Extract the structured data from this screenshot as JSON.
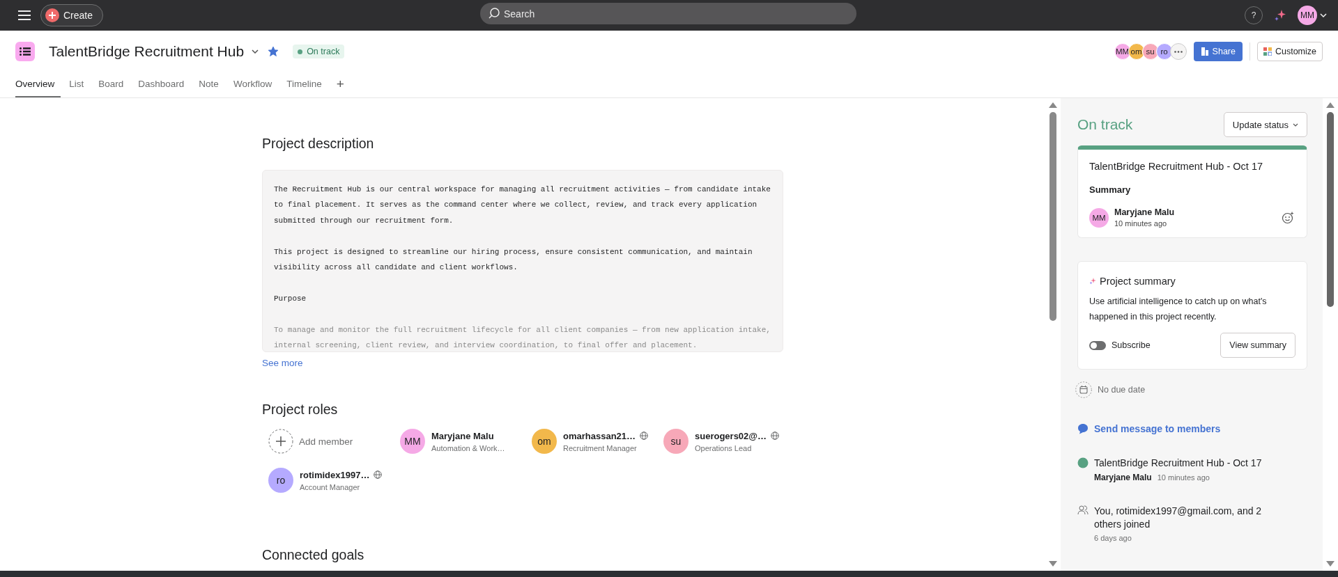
{
  "topbar": {
    "create_label": "Create",
    "search_placeholder": "Search",
    "help": "?",
    "user_initials": "MM"
  },
  "project": {
    "title": "TalentBridge Recruitment Hub",
    "status": "On track",
    "starred": true
  },
  "tabs": [
    {
      "label": "Overview",
      "selected": true
    },
    {
      "label": "List",
      "selected": false
    },
    {
      "label": "Board",
      "selected": false
    },
    {
      "label": "Dashboard",
      "selected": false
    },
    {
      "label": "Note",
      "selected": false
    },
    {
      "label": "Workflow",
      "selected": false
    },
    {
      "label": "Timeline",
      "selected": false
    }
  ],
  "add_tab": "+",
  "member_stack": [
    {
      "initials": "MM",
      "color": "#f5a9e6"
    },
    {
      "initials": "om",
      "color": "#f2b84b"
    },
    {
      "initials": "su",
      "color": "#f7a8b8"
    },
    {
      "initials": "ro",
      "color": "#b5aaff"
    }
  ],
  "share_label": "Share",
  "customize_label": "Customize",
  "description": {
    "heading": "Project description",
    "paragraphs": [
      "The Recruitment Hub is our central workspace for managing all recruitment activities — from candidate intake to final placement. It serves as the command center where we collect, review, and track every application submitted through our recruitment form.",
      "This project is designed to streamline our hiring process, ensure consistent communication, and maintain visibility across all candidate and client workflows.",
      "Purpose",
      "To manage and monitor the full recruitment lifecycle for all client companies — from new application intake, internal screening, client review, and interview coordination, to final offer and placement."
    ],
    "see_more": "See more"
  },
  "roles": {
    "heading": "Project roles",
    "add_member": "Add member",
    "members": [
      {
        "initials": "MM",
        "color": "#f5a9e6",
        "name": "Maryjane Malu",
        "role": "Automation & Work…",
        "external": false
      },
      {
        "initials": "om",
        "color": "#f2b84b",
        "name": "omarhassan21…",
        "role": "Recruitment Manager",
        "external": true
      },
      {
        "initials": "su",
        "color": "#f7a8b8",
        "name": "suerogers02@…",
        "role": "Operations Lead",
        "external": true
      },
      {
        "initials": "ro",
        "color": "#b5aaff",
        "name": "rotimidex1997…",
        "role": "Account Manager",
        "external": true
      }
    ]
  },
  "goals_heading": "Connected goals",
  "status_panel": {
    "status": "On track",
    "update_button": "Update status",
    "card": {
      "title": "TalentBridge Recruitment Hub - Oct 17",
      "section": "Summary",
      "initials": "MM",
      "color": "#f5a9e6",
      "author": "Maryjane Malu",
      "time": "10 minutes ago"
    },
    "summary": {
      "title": "Project summary",
      "text": "Use artificial intelligence to catch up on what's happened in this project recently.",
      "toggle_label": "Subscribe",
      "subscribed": false,
      "button": "View summary"
    },
    "due": "No due date",
    "send_message": "Send message to members",
    "update": {
      "title": "TalentBridge Recruitment Hub - Oct 17",
      "author": "Maryjane Malu",
      "time": "10 minutes ago"
    },
    "joined": {
      "text": "You, rotimidex1997@gmail.com, and 2 others joined",
      "time": "6 days ago"
    }
  }
}
